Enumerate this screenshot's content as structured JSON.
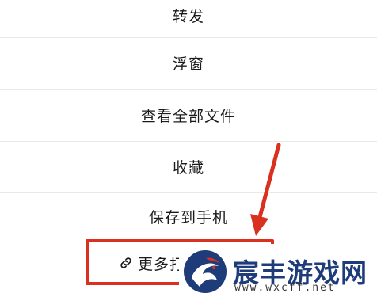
{
  "menu": {
    "items": [
      {
        "label": "转发"
      },
      {
        "label": "浮窗"
      },
      {
        "label": "查看全部文件"
      },
      {
        "label": "收藏"
      },
      {
        "label": "保存到手机"
      }
    ],
    "more": {
      "label": "更多打",
      "icon": "link-icon"
    }
  },
  "annotation": {
    "color": "#d9301f"
  },
  "watermark": {
    "title": "宸丰游戏网",
    "url": "www.wxcff.net",
    "title_color": "#1e3c7a"
  }
}
